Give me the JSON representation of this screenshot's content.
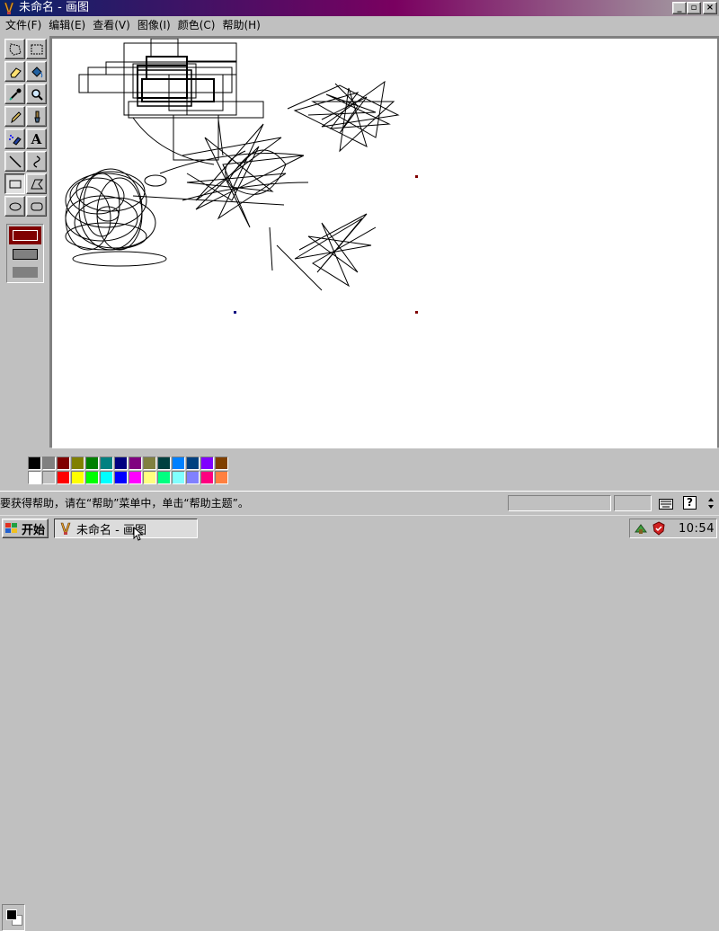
{
  "window": {
    "title": "未命名 - 画图",
    "buttons": {
      "minimize": "_",
      "restore": "▫",
      "close": "×"
    }
  },
  "menu": [
    "文件(F)",
    "编辑(E)",
    "查看(V)",
    "图像(I)",
    "颜色(C)",
    "帮助(H)"
  ],
  "tools": [
    {
      "name": "free-select-icon"
    },
    {
      "name": "rect-select-icon"
    },
    {
      "name": "eraser-icon"
    },
    {
      "name": "fill-icon"
    },
    {
      "name": "pick-color-icon"
    },
    {
      "name": "magnifier-icon"
    },
    {
      "name": "pencil-icon"
    },
    {
      "name": "brush-icon"
    },
    {
      "name": "airbrush-icon"
    },
    {
      "name": "text-icon",
      "label": "A"
    },
    {
      "name": "line-icon"
    },
    {
      "name": "curve-icon"
    },
    {
      "name": "rectangle-icon",
      "active": true
    },
    {
      "name": "polygon-icon"
    },
    {
      "name": "ellipse-icon"
    },
    {
      "name": "rounded-rect-icon"
    }
  ],
  "palette": {
    "foreground": "#000000",
    "background": "#ffffff",
    "row1": [
      "#000000",
      "#808080",
      "#800000",
      "#808000",
      "#008000",
      "#008080",
      "#000080",
      "#800080",
      "#808040",
      "#004040",
      "#0080ff",
      "#004080",
      "#8000ff",
      "#804000"
    ],
    "row2": [
      "#ffffff",
      "#c0c0c0",
      "#ff0000",
      "#ffff00",
      "#00ff00",
      "#00ffff",
      "#0000ff",
      "#ff00ff",
      "#ffff80",
      "#00ff80",
      "#80ffff",
      "#8080ff",
      "#ff0080",
      "#ff8040"
    ]
  },
  "status": {
    "message": "要获得帮助，请在“帮助”菜单中，单击“帮助主题”。"
  },
  "taskbar": {
    "start_label": "开始",
    "task_label": "未命名 - 画图",
    "clock": "10:54"
  }
}
